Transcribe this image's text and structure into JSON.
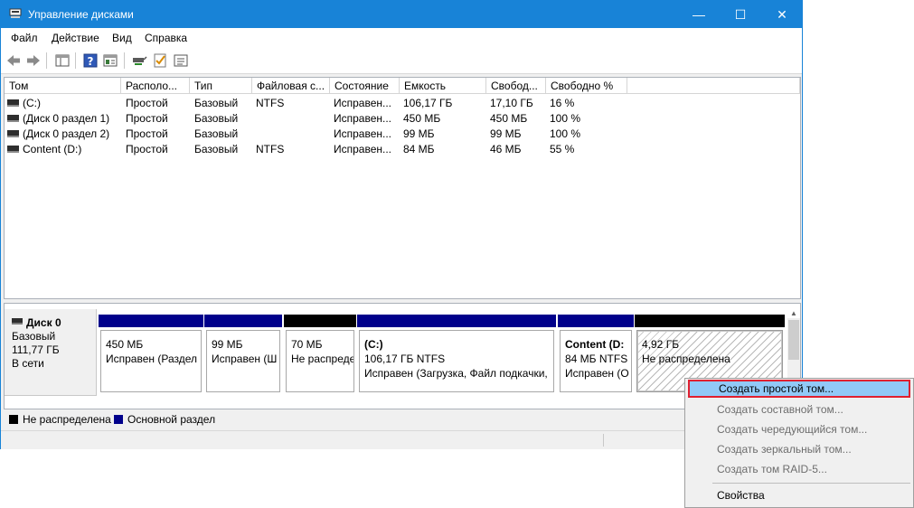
{
  "window": {
    "title": "Управление дисками",
    "controls": {
      "minimize": "—",
      "maximize": "☐",
      "close": "✕"
    },
    "accent_color": "#1883d7"
  },
  "menu": [
    "Файл",
    "Действие",
    "Вид",
    "Справка"
  ],
  "toolbar_icons": [
    "back-arrow-icon",
    "forward-arrow-icon",
    "console-tree-icon",
    "help-icon",
    "properties-icon",
    "connect-icon",
    "check-icon",
    "list-icon"
  ],
  "volume_list": {
    "columns": [
      "Том",
      "Располо...",
      "Тип",
      "Файловая с...",
      "Состояние",
      "Емкость",
      "Свобод...",
      "Свободно %"
    ],
    "rows": [
      {
        "name": "(C:)",
        "layout": "Простой",
        "type": "Базовый",
        "fs": "NTFS",
        "status": "Исправен...",
        "capacity": "106,17 ГБ",
        "free": "17,10 ГБ",
        "free_pct": "16 %"
      },
      {
        "name": "(Диск 0 раздел 1)",
        "layout": "Простой",
        "type": "Базовый",
        "fs": "",
        "status": "Исправен...",
        "capacity": "450 МБ",
        "free": "450 МБ",
        "free_pct": "100 %"
      },
      {
        "name": "(Диск 0 раздел 2)",
        "layout": "Простой",
        "type": "Базовый",
        "fs": "",
        "status": "Исправен...",
        "capacity": "99 МБ",
        "free": "99 МБ",
        "free_pct": "100 %"
      },
      {
        "name": "Content (D:)",
        "layout": "Простой",
        "type": "Базовый",
        "fs": "NTFS",
        "status": "Исправен...",
        "capacity": "84 МБ",
        "free": "46 МБ",
        "free_pct": "55 %"
      }
    ]
  },
  "disk": {
    "name": "Диск 0",
    "type": "Базовый",
    "size": "111,77 ГБ",
    "state": "В сети",
    "partitions": [
      {
        "title": "",
        "size": "450 МБ",
        "status": "Исправен (Раздел",
        "color": "#00008b"
      },
      {
        "title": "",
        "size": "99 МБ",
        "status": "Исправен (Ш",
        "color": "#00008b"
      },
      {
        "title": "",
        "size": "70 МБ",
        "status": "Не распреде",
        "color": "#000000"
      },
      {
        "title": "(C:)",
        "size": "106,17 ГБ NTFS",
        "status": "Исправен (Загрузка, Файл подкачки, ",
        "color": "#00008b"
      },
      {
        "title": "Content  (D:",
        "size": "84 МБ NTFS",
        "status": "Исправен (О",
        "color": "#00008b"
      },
      {
        "title": "",
        "size": "4,92 ГБ",
        "status": "Не распределена",
        "color": "#000000"
      }
    ]
  },
  "legend": [
    {
      "label": "Не распределена",
      "color": "#000000"
    },
    {
      "label": "Основной раздел",
      "color": "#00008b"
    }
  ],
  "context_menu": {
    "items": [
      {
        "label": "Создать простой том...",
        "enabled": true,
        "highlighted": true
      },
      {
        "label": "Создать составной том...",
        "enabled": false
      },
      {
        "label": "Создать чередующийся том...",
        "enabled": false
      },
      {
        "label": "Создать зеркальный том...",
        "enabled": false
      },
      {
        "label": "Создать том RAID-5...",
        "enabled": false
      },
      {
        "label": "Свойства",
        "enabled": true
      }
    ]
  }
}
